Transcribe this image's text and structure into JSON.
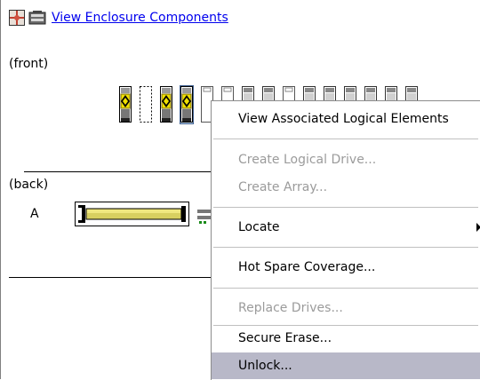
{
  "header": {
    "link_text": "View Enclosure Components",
    "icons": [
      "enclosure-grid-icon",
      "enclosure-components-icon"
    ]
  },
  "labels": {
    "front": "(front)",
    "back": "(back)",
    "controller_a": "A"
  },
  "bays": [
    {
      "state": "selected-drive"
    },
    {
      "state": "empty-slot"
    },
    {
      "state": "selected-drive"
    },
    {
      "state": "selected-drive-focused"
    },
    {
      "state": "empty-outline"
    },
    {
      "state": "empty-outline"
    },
    {
      "state": "drive"
    },
    {
      "state": "drive"
    },
    {
      "state": "empty-outline"
    },
    {
      "state": "drive"
    },
    {
      "state": "drive"
    },
    {
      "state": "drive"
    },
    {
      "state": "drive"
    },
    {
      "state": "drive"
    },
    {
      "state": "drive"
    }
  ],
  "context_menu": {
    "items": [
      {
        "label": "View Associated Logical Elements",
        "enabled": true
      },
      {
        "label": "Create Logical Drive...",
        "enabled": false
      },
      {
        "label": "Create Array...",
        "enabled": false
      },
      {
        "label": "Locate",
        "enabled": true,
        "submenu": true
      },
      {
        "label": "Hot Spare Coverage...",
        "enabled": true
      },
      {
        "label": "Replace Drives...",
        "enabled": false
      },
      {
        "label": "Secure Erase...",
        "enabled": true
      },
      {
        "label": "Unlock...",
        "enabled": true,
        "highlighted": true
      }
    ]
  },
  "colors": {
    "link": "#0000ee",
    "drive_yellow": "#f0e000",
    "menu_highlight": "#b8b8c8",
    "disabled_text": "#9b9b9b"
  }
}
